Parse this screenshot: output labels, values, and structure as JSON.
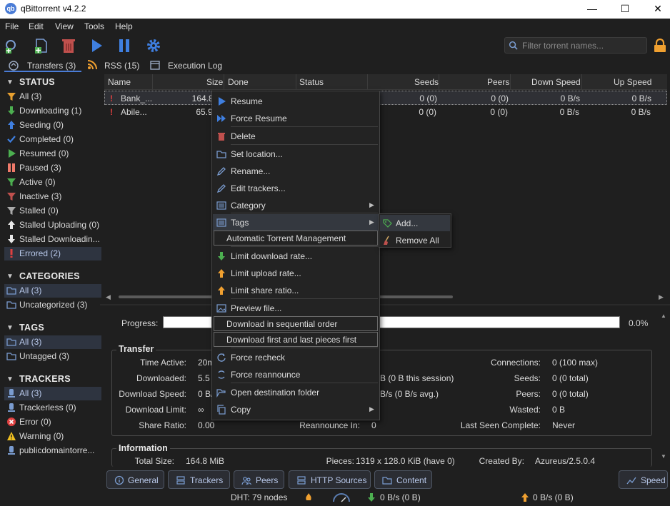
{
  "app": {
    "title": "qBittorrent v4.2.2"
  },
  "menubar": [
    "File",
    "Edit",
    "View",
    "Tools",
    "Help"
  ],
  "search": {
    "placeholder": "Filter torrent names..."
  },
  "tabs": {
    "transfers": "Transfers (3)",
    "rss": "RSS (15)",
    "log": "Execution Log"
  },
  "sidebar": {
    "status_title": "STATUS",
    "status": [
      {
        "label": "All (3)",
        "icon": "funnel-icon",
        "color": "#e8a030"
      },
      {
        "label": "Downloading (1)",
        "icon": "down-arrow-icon",
        "color": "#4caf50"
      },
      {
        "label": "Seeding (0)",
        "icon": "up-arrow-icon",
        "color": "#3f7fe0"
      },
      {
        "label": "Completed (0)",
        "icon": "check-icon",
        "color": "#3f7fe0"
      },
      {
        "label": "Resumed (0)",
        "icon": "play-icon",
        "color": "#4caf50"
      },
      {
        "label": "Paused (3)",
        "icon": "pause-icon",
        "color": "#ef7a6a"
      },
      {
        "label": "Active (0)",
        "icon": "funnel-icon",
        "color": "#4caf50"
      },
      {
        "label": "Inactive (3)",
        "icon": "funnel-icon",
        "color": "#c0504d"
      },
      {
        "label": "Stalled (0)",
        "icon": "funnel-icon",
        "color": "#aaaaaa"
      },
      {
        "label": "Stalled Uploading (0)",
        "icon": "up-arrow-icon",
        "color": "#e8e8e8"
      },
      {
        "label": "Stalled Downloadin...",
        "icon": "down-arrow-icon",
        "color": "#e8e8e8"
      },
      {
        "label": "Errored (2)",
        "icon": "exclamation-icon",
        "color": "#e04040",
        "selected": true
      }
    ],
    "categories_title": "CATEGORIES",
    "categories": [
      {
        "label": "All (3)",
        "icon": "folder-icon",
        "selected": true
      },
      {
        "label": "Uncategorized (3)",
        "icon": "folder-icon"
      }
    ],
    "tags_title": "TAGS",
    "tags": [
      {
        "label": "All (3)",
        "icon": "folder-icon",
        "selected": true
      },
      {
        "label": "Untagged (3)",
        "icon": "folder-icon"
      }
    ],
    "trackers_title": "TRACKERS",
    "trackers": [
      {
        "label": "All (3)",
        "icon": "tracker-icon",
        "color": "#7a9cd0",
        "selected": true
      },
      {
        "label": "Trackerless (0)",
        "icon": "tracker-icon",
        "color": "#7a9cd0"
      },
      {
        "label": "Error (0)",
        "icon": "error-circle-icon",
        "color": "#e04040"
      },
      {
        "label": "Warning (0)",
        "icon": "warning-icon",
        "color": "#f0c020"
      },
      {
        "label": "publicdomaintorre...",
        "icon": "tracker-icon",
        "color": "#7a9cd0"
      }
    ]
  },
  "table": {
    "headers": [
      "Name",
      "Size",
      "Done",
      "Status",
      "Seeds",
      "Peers",
      "Down Speed",
      "Up Speed"
    ],
    "rows": [
      {
        "name": "Bank_...",
        "size": "164.8 M",
        "seeds": "0 (0)",
        "peers": "0 (0)",
        "down": "0 B/s",
        "up": "0 B/s"
      },
      {
        "name": "Abile...",
        "size": "65.9 M",
        "seeds": "0 (0)",
        "peers": "0 (0)",
        "down": "0 B/s",
        "up": "0 B/s"
      }
    ]
  },
  "progress": {
    "label": "Progress:",
    "value": "0.0%"
  },
  "transfer": {
    "title": "Transfer",
    "time_active_label": "Time Active:",
    "time_active": "20m",
    "downloaded_label": "Downloaded:",
    "downloaded": "5.5 M",
    "uploaded_partial": "B (0 B this session)",
    "dl_speed_label": "Download Speed:",
    "dl_speed": "0 B/",
    "ul_speed_partial": "B/s (0 B/s avg.)",
    "dl_limit_label": "Download Limit:",
    "dl_limit": "∞",
    "share_ratio_label": "Share Ratio:",
    "share_ratio": "0.00",
    "reannounce_label": "Reannounce In:",
    "reannounce": "0",
    "connections_label": "Connections:",
    "connections": "0 (100 max)",
    "seeds_label": "Seeds:",
    "seeds": "0 (0 total)",
    "peers_label": "Peers:",
    "peers": "0 (0 total)",
    "wasted_label": "Wasted:",
    "wasted": "0 B",
    "last_seen_label": "Last Seen Complete:",
    "last_seen": "Never"
  },
  "information": {
    "title": "Information",
    "total_size_label": "Total Size:",
    "total_size": "164.8 MiB",
    "pieces_label": "Pieces:",
    "pieces": "1319 x 128.0 KiB (have 0)",
    "created_by_label": "Created By:",
    "created_by": "Azureus/2.5.0.4"
  },
  "bottom_tabs": [
    "General",
    "Trackers",
    "Peers",
    "HTTP Sources",
    "Content"
  ],
  "speed_button": "Speed",
  "statusbar": {
    "dht": "DHT: 79 nodes",
    "down": "0 B/s (0 B)",
    "up": "0 B/s (0 B)"
  },
  "context_menu": {
    "items": [
      {
        "label": "Resume",
        "icon": "play-icon",
        "color": "#3f7fe0"
      },
      {
        "label": "Force Resume",
        "icon": "fast-forward-icon",
        "color": "#3f7fe0"
      },
      {
        "label": "Delete",
        "icon": "trash-icon",
        "color": "#c0504d"
      },
      {
        "label": "Set location...",
        "icon": "folder-icon",
        "color": "#7a9cd0"
      },
      {
        "label": "Rename...",
        "icon": "pencil-icon",
        "color": "#7a9cd0"
      },
      {
        "label": "Edit trackers...",
        "icon": "pencil-icon",
        "color": "#7a9cd0"
      },
      {
        "label": "Category",
        "icon": "list-icon",
        "color": "#7a9cd0"
      },
      {
        "label": "Tags",
        "icon": "list-icon",
        "color": "#7a9cd0"
      },
      {
        "label": "Automatic Torrent Management"
      },
      {
        "label": "Limit download rate...",
        "icon": "down-arrow-icon",
        "color": "#4caf50"
      },
      {
        "label": "Limit upload rate...",
        "icon": "up-arrow-icon",
        "color": "#f0a030"
      },
      {
        "label": "Limit share ratio...",
        "icon": "up-arrow-icon",
        "color": "#f0a030"
      },
      {
        "label": "Preview file...",
        "icon": "image-icon",
        "color": "#7a9cd0"
      },
      {
        "label": "Download in sequential order"
      },
      {
        "label": "Download first and last pieces first"
      },
      {
        "label": "Force recheck",
        "icon": "recheck-icon",
        "color": "#7a9cd0"
      },
      {
        "label": "Force reannounce",
        "icon": "reannounce-icon",
        "color": "#7a9cd0"
      },
      {
        "label": "Open destination folder",
        "icon": "folder-open-icon",
        "color": "#7a9cd0"
      },
      {
        "label": "Copy",
        "icon": "copy-icon",
        "color": "#7a9cd0"
      }
    ],
    "submenu": [
      {
        "label": "Add...",
        "icon": "tag-add-icon",
        "color": "#4caf50"
      },
      {
        "label": "Remove All",
        "icon": "broom-icon",
        "color": "#c0504d"
      }
    ]
  }
}
